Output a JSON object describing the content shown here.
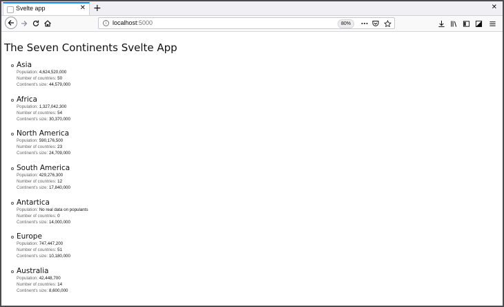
{
  "browser": {
    "tab": {
      "title": "Svelte app"
    },
    "url": {
      "host": "localhost",
      "port": ":5000"
    },
    "zoom": "80%",
    "icons": [
      "back-icon",
      "forward-icon",
      "reload-icon",
      "home-icon",
      "info-icon",
      "page-actions-icon",
      "pocket-icon",
      "bookmark-star-icon",
      "download-icon",
      "library-icon",
      "sidebar-icon",
      "screenshot-icon",
      "menu-icon"
    ]
  },
  "page": {
    "title": "The Seven Continents Svelte App",
    "labels": {
      "population": "Population:",
      "countries": "Number of countries:",
      "size": "Continent's size:"
    },
    "continents": [
      {
        "name": "Asia",
        "population": "4,624,520,000",
        "countries": "50",
        "size": "44,579,000"
      },
      {
        "name": "Africa",
        "population": "1,327,042,300",
        "countries": "54",
        "size": "30,370,000"
      },
      {
        "name": "North America",
        "population": "590,176,500",
        "countries": "23",
        "size": "24,709,000"
      },
      {
        "name": "South America",
        "population": "429,276,300",
        "countries": "12",
        "size": "17,840,000"
      },
      {
        "name": "Antartica",
        "population": "No real data on populants",
        "countries": "0",
        "size": "14,000,000"
      },
      {
        "name": "Europe",
        "population": "747,447,200",
        "countries": "51",
        "size": "10,180,000"
      },
      {
        "name": "Australia",
        "population": "42,448,700",
        "countries": "14",
        "size": "8,600,000"
      }
    ]
  }
}
